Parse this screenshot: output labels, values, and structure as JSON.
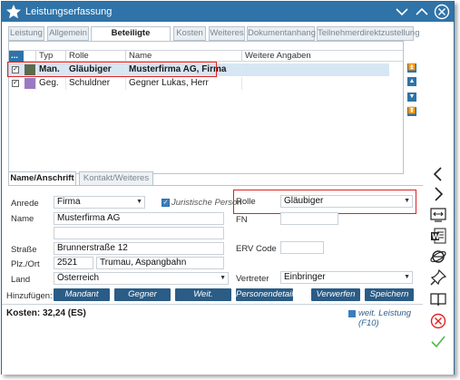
{
  "window": {
    "title": "Leistungserfassung"
  },
  "top_tabs": [
    {
      "label": "Leistung",
      "active": false
    },
    {
      "label": "Allgemein",
      "active": false
    },
    {
      "label": "Beteiligte Personen",
      "active": true
    },
    {
      "label": "Kosten",
      "active": false
    },
    {
      "label": "Weiteres",
      "active": false
    },
    {
      "label": "Dokumentanhang",
      "active": false
    },
    {
      "label": "Teilnehmerdirektzustellung",
      "active": false
    }
  ],
  "grid": {
    "columns": [
      "...",
      "Typ",
      "Rolle",
      "Name",
      "Weitere Angaben"
    ],
    "rows": [
      {
        "checked": true,
        "color": "#5a6b4e",
        "typ": "Man.",
        "rolle": "Gläubiger",
        "name": "Musterfirma AG, Firma",
        "weitere": "",
        "selected": true
      },
      {
        "checked": true,
        "color": "#9a7ac2",
        "typ": "Geg.",
        "rolle": "Schuldner",
        "name": "Gegner Lukas, Herr",
        "weitere": "",
        "selected": false
      }
    ]
  },
  "form_tabs": [
    {
      "label": "Name/Anschrift",
      "active": true
    },
    {
      "label": "Kontakt/Weiteres",
      "active": false
    }
  ],
  "form": {
    "anrede_label": "Anrede",
    "anrede_value": "Firma",
    "juristische_label": "Juristische Person",
    "juristische_checked": true,
    "name_label": "Name",
    "name_value": "Musterfirma AG",
    "name2_value": "",
    "strasse_label": "Straße",
    "strasse_value": "Brunnerstraße 12",
    "plzort_label": "Plz./Ort",
    "plz_value": "2521",
    "ort_value": "Trumau, Aspangbahn",
    "land_label": "Land",
    "land_value": "Österreich",
    "rolle_label": "Rolle",
    "rolle_value": "Gläubiger",
    "fn_label": "FN",
    "fn_value": "",
    "erv_label": "ERV Code",
    "erv_value": "",
    "vertreter_label": "Vertreter",
    "vertreter_value": "Einbringer"
  },
  "buttons": {
    "hinzufuegen_label": "Hinzufügen:",
    "mandant": "Mandant",
    "gegner": "Gegner",
    "weit_beteiligte": "Weit. Beteiligte",
    "personendetails": "Personendetails",
    "verwerfen": "Verwerfen",
    "speichern": "Speichern"
  },
  "status": {
    "kosten": "Kosten: 32,24 (ES)",
    "weit_leistung": "weit. Leistung (F10)",
    "weit_leistung_color": "#3a7ec0"
  },
  "colors": {
    "titlebar": "#2f73a8",
    "button": "#2a5c86",
    "highlight": "#e02222",
    "selected_row": "#d7e6f3"
  },
  "right_toolbar_icons": [
    "chevron-left-icon",
    "chevron-right-icon",
    "fit-width-icon",
    "word-document-icon",
    "browser-icon",
    "pin-icon",
    "book-icon",
    "cancel-icon",
    "confirm-check-icon"
  ]
}
